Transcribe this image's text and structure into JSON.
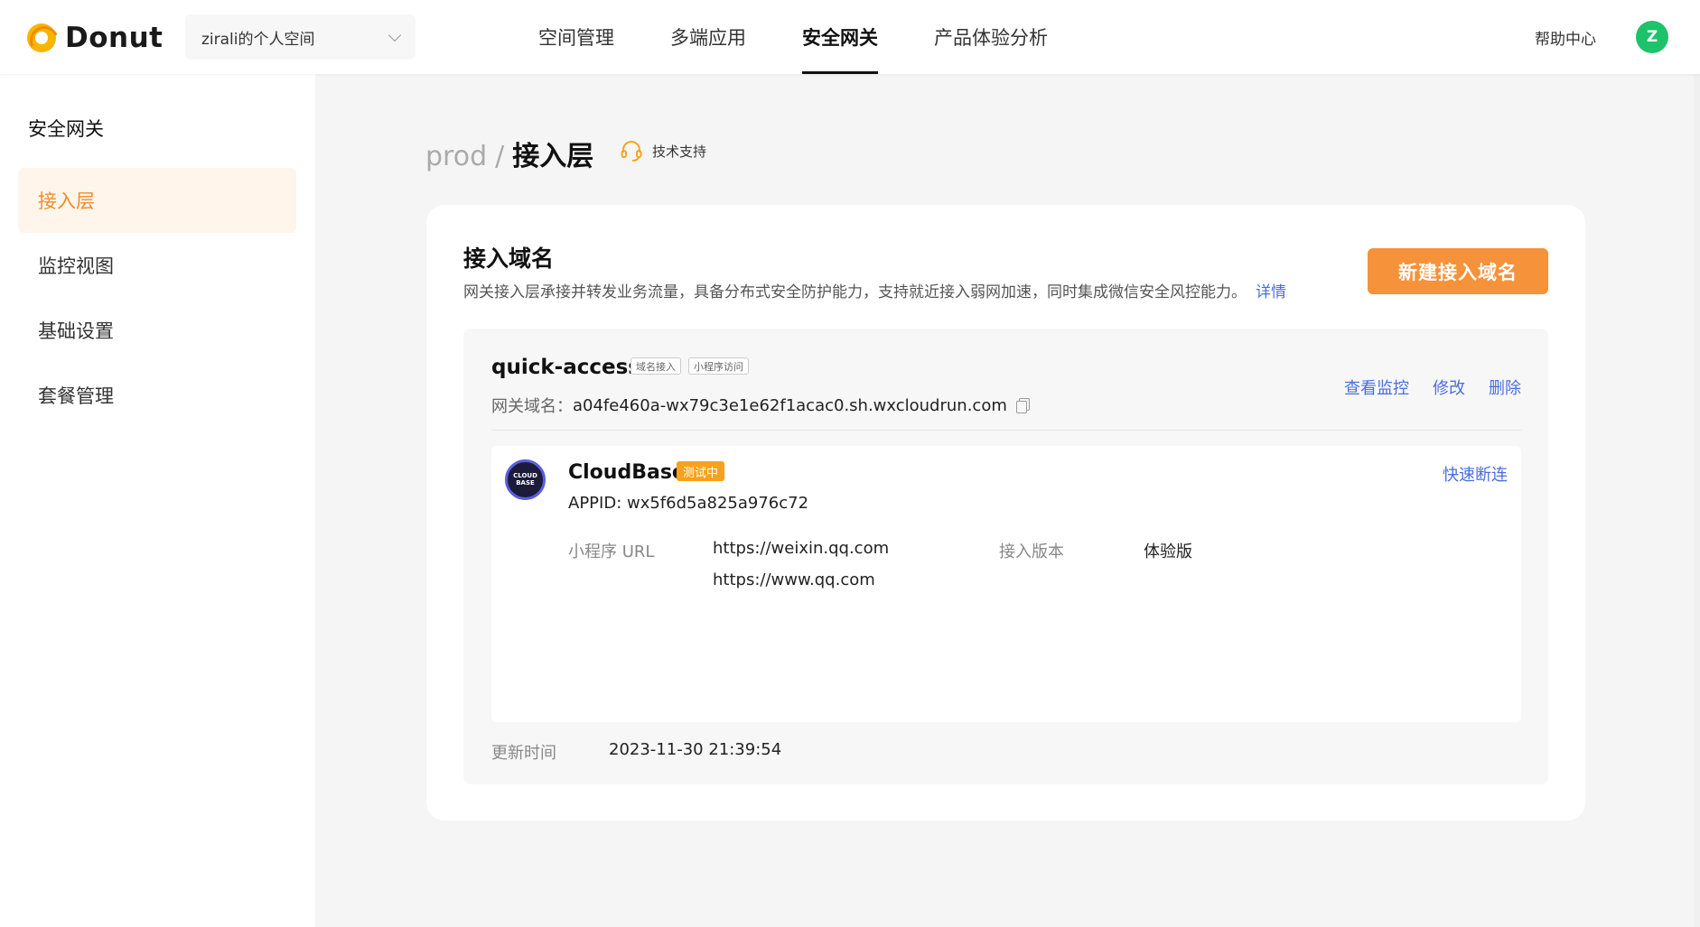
{
  "app": {
    "logo_text": "Donut"
  },
  "workspace": {
    "label": "zirali的个人空间"
  },
  "topnav": {
    "items": [
      {
        "label": "空间管理"
      },
      {
        "label": "多端应用"
      },
      {
        "label": "安全网关"
      },
      {
        "label": "产品体验分析"
      }
    ],
    "active_index": 2
  },
  "header": {
    "help_label": "帮助中心",
    "avatar_letter": "Z"
  },
  "sidebar": {
    "title": "安全网关",
    "items": [
      {
        "label": "接入层"
      },
      {
        "label": "监控视图"
      },
      {
        "label": "基础设置"
      },
      {
        "label": "套餐管理"
      }
    ],
    "active_index": 0
  },
  "breadcrumb": {
    "env": "prod",
    "separator": "/",
    "page": "接入层",
    "support_label": "技术支持"
  },
  "section": {
    "title": "接入域名",
    "description": "网关接入层承接并转发业务流量，具备分布式安全防护能力，支持就近接入弱网加速，同时集成微信安全风控能力。",
    "detail_link": "详情",
    "new_button": "新建接入域名"
  },
  "gateway": {
    "name": "quick-access",
    "tags": [
      "域名接入",
      "小程序访问"
    ],
    "domain_label": "网关域名：",
    "domain": "a04fe460a-wx79c3e1e62f1acac0.sh.wxcloudrun.com",
    "actions": {
      "monitor": "查看监控",
      "edit": "修改",
      "delete": "删除"
    },
    "app": {
      "logo_text_1": "CLOUD",
      "logo_text_2": "BASE",
      "name": "CloudBase",
      "badge": "测试中",
      "appid": "APPID: wx5f6d5a825a976c72",
      "disconnect": "快速断连",
      "url_label": "小程序 URL",
      "urls": [
        "https://weixin.qq.com",
        "https://www.qq.com"
      ],
      "version_label": "接入版本",
      "version": "体验版"
    },
    "updated_label": "更新时间",
    "updated_value": "2023-11-30 21:39:54"
  },
  "colors": {
    "accent": "#f5923a",
    "link": "#4a6ee0",
    "badge": "#f7a21b",
    "avatar": "#1ec26b"
  }
}
